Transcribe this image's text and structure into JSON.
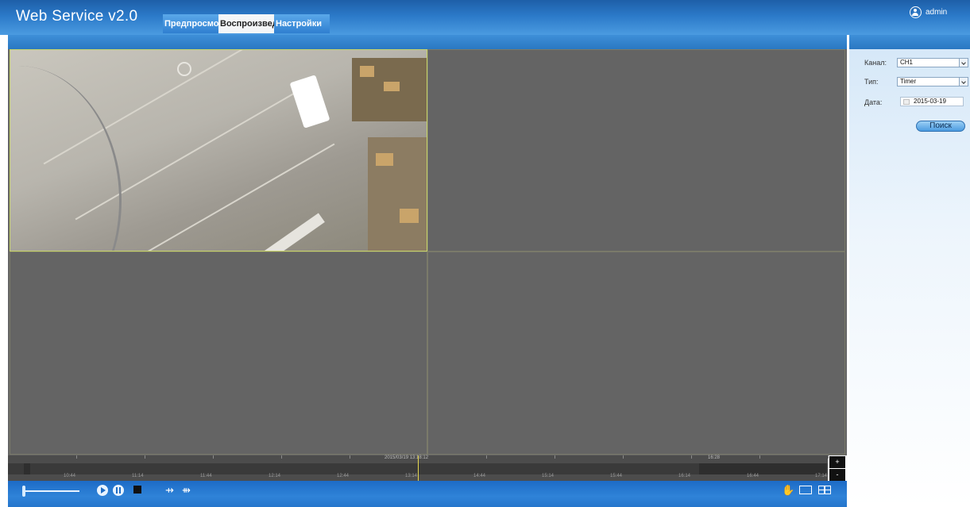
{
  "header": {
    "app_title": "Web Service v2.0",
    "tabs": [
      {
        "label": "Предпросмотр"
      },
      {
        "label": "Воспроизведение"
      },
      {
        "label": "Настройки"
      }
    ],
    "user": "admin"
  },
  "timeline": {
    "date_label": "2015/03/19 13:18:12",
    "mark_label": "16:28",
    "zoom_in": "+",
    "zoom_out": "-",
    "time_labels": [
      "10:44",
      "11:14",
      "11:44",
      "12:14",
      "12:44",
      "13:14",
      "14:44",
      "15:14",
      "15:44",
      "16:14",
      "16:44",
      "17:14"
    ]
  },
  "controls": {
    "volume_level": 0.05,
    "icons": {
      "play": "play-icon",
      "pause": "pause-icon",
      "stop": "stop-icon",
      "slow": "slow-forward-icon",
      "fast": "fast-forward-icon",
      "hand": "hand-icon",
      "layout1": "single-layout-icon",
      "layout4": "quad-layout-icon"
    }
  },
  "search_panel": {
    "channel_label": "Канал:",
    "channel_value": "CH1",
    "type_label": "Тип:",
    "type_value": "Timer",
    "date_label": "Дата:",
    "date_value": "2015-03-19",
    "search_button": "Поиск"
  },
  "colors": {
    "header_blue": "#2b79c8",
    "video_bg": "#646464",
    "selected_cell_border": "#c7d46a",
    "timeline_cursor": "#e6d850"
  }
}
